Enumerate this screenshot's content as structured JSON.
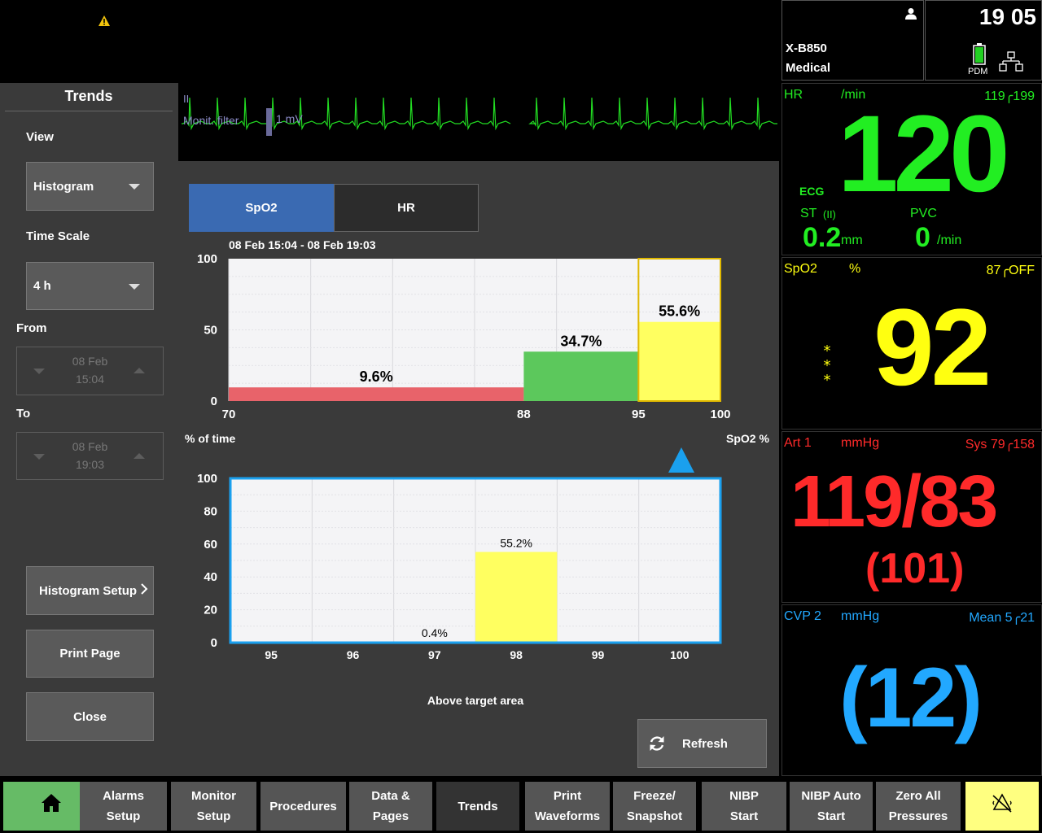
{
  "header": {
    "device_line1": "X-B850",
    "device_line2": "Medical",
    "time": "19 05",
    "pdm_label": "PDM"
  },
  "ecg_strip": {
    "lead": "II",
    "filter_label": "Monit. filter",
    "scale_label": "1 mV"
  },
  "trends_panel": {
    "title": "Trends",
    "view_label": "View",
    "view_value": "Histogram",
    "time_scale_label": "Time Scale",
    "time_scale_value": "4 h",
    "from_label": "From",
    "from_date": "08 Feb",
    "from_time": "15:04",
    "to_label": "To",
    "to_date": "08 Feb",
    "to_time": "19:03",
    "histogram_setup": "Histogram Setup",
    "print_page": "Print Page",
    "close": "Close"
  },
  "tabs": [
    {
      "label": "SpO2",
      "active": true
    },
    {
      "label": "HR",
      "active": false
    }
  ],
  "chart_data": [
    {
      "type": "bar",
      "title": "08 Feb 15:04 - 08 Feb 19:03",
      "xlabel": "SpO2 %",
      "ylabel": "% of time",
      "x_ticks": [
        "70",
        "88",
        "95",
        "100"
      ],
      "y_ticks": [
        "100",
        "50",
        "0"
      ],
      "ylim": [
        0,
        100
      ],
      "bins": [
        {
          "from": 70,
          "to": 88,
          "value": 9.6,
          "label": "9.6%",
          "color": "#e8636a"
        },
        {
          "from": 88,
          "to": 95,
          "value": 34.7,
          "label": "34.7%",
          "color": "#5cc85c"
        },
        {
          "from": 95,
          "to": 100,
          "value": 55.6,
          "label": "55.6%",
          "color": "#ffff60"
        }
      ]
    },
    {
      "type": "bar",
      "title": "Above target area",
      "categories": [
        "95",
        "96",
        "97",
        "98",
        "99",
        "100"
      ],
      "values": [
        0,
        0,
        0.4,
        55.2,
        0,
        0
      ],
      "labels": [
        "",
        "",
        "0.4%",
        "55.2%",
        "",
        ""
      ],
      "y_ticks": [
        "100",
        "80",
        "60",
        "40",
        "20",
        "0"
      ],
      "ylim": [
        0,
        100
      ],
      "color": "#ffff60"
    }
  ],
  "refresh_label": "Refresh",
  "hr": {
    "label": "HR",
    "unit": "/min",
    "limits": "119╭199",
    "value": "120",
    "source": "ECG",
    "st_label": "ST",
    "st_lead": "(II)",
    "st_value": "0.2",
    "st_unit": "mm",
    "pvc_label": "PVC",
    "pvc_value": "0",
    "pvc_unit": "/min",
    "color": "#22ee22"
  },
  "spo2": {
    "label": "SpO2",
    "unit": "%",
    "limits": "87╭OFF",
    "value": "92",
    "color": "#ffff10"
  },
  "art": {
    "label": "Art 1",
    "unit": "mmHg",
    "limits": "Sys 79╭158",
    "value": "119/83",
    "mean": "(101)",
    "color": "#ff2a2a"
  },
  "cvp": {
    "label": "CVP 2",
    "unit": "mmHg",
    "limits": "Mean 5╭21",
    "value": "(12)",
    "color": "#22a8ff"
  },
  "bottom_bar": [
    {
      "name": "home",
      "label": ""
    },
    {
      "name": "alarms-setup",
      "line1": "Alarms",
      "line2": "Setup"
    },
    {
      "name": "monitor-setup",
      "line1": "Monitor",
      "line2": "Setup"
    },
    {
      "name": "procedures",
      "line1": "Procedures",
      "line2": ""
    },
    {
      "name": "data-pages",
      "line1": "Data &",
      "line2": "Pages"
    },
    {
      "name": "trends",
      "line1": "Trends",
      "line2": ""
    },
    {
      "name": "print-waveforms",
      "line1": "Print",
      "line2": "Waveforms"
    },
    {
      "name": "freeze-snapshot",
      "line1": "Freeze/",
      "line2": "Snapshot"
    },
    {
      "name": "nibp-start",
      "line1": "NIBP",
      "line2": "Start"
    },
    {
      "name": "nibp-auto-start",
      "line1": "NIBP Auto",
      "line2": "Start"
    },
    {
      "name": "zero-all-pressures",
      "line1": "Zero All",
      "line2": "Pressures"
    },
    {
      "name": "alarm-silence",
      "label": ""
    }
  ]
}
